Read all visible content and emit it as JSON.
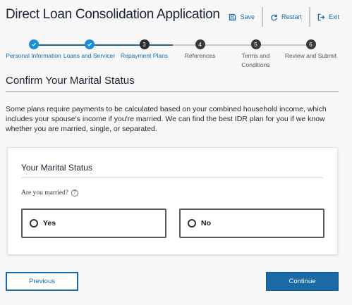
{
  "app": {
    "title": "Direct Loan Consolidation Application"
  },
  "header": {
    "save_label": "Save",
    "restart_label": "Restart",
    "exit_label": "Exit"
  },
  "stepper": {
    "steps": [
      {
        "label": "Personal Information",
        "status": "done",
        "number": "1"
      },
      {
        "label": "Loans and Servicer",
        "status": "done",
        "number": "2"
      },
      {
        "label": "Repayment Plans",
        "status": "current",
        "number": "3"
      },
      {
        "label": "References",
        "status": "todo",
        "number": "4"
      },
      {
        "label": "Terms and Conditions",
        "status": "todo",
        "number": "5"
      },
      {
        "label": "Review and Submit",
        "status": "todo",
        "number": "6"
      }
    ]
  },
  "section": {
    "title": "Confirm Your Marital Status",
    "intro": "Some plans require payments to be calculated based on your combined household income, which includes your spouse's income if you're married. We can find the best IDR plan for you if we know whether you are married, single, or separated."
  },
  "card": {
    "title": "Your Marital Status",
    "question": "Are you married?",
    "help_icon": "?",
    "options": [
      {
        "label": "Yes",
        "selected": false
      },
      {
        "label": "No",
        "selected": false
      }
    ]
  },
  "footer": {
    "previous_label": "Previous",
    "continue_label": "Continue"
  },
  "colors": {
    "accent": "#1a6aa8",
    "step_done": "#1a8fd6",
    "step_todo": "#3a3a3a"
  }
}
